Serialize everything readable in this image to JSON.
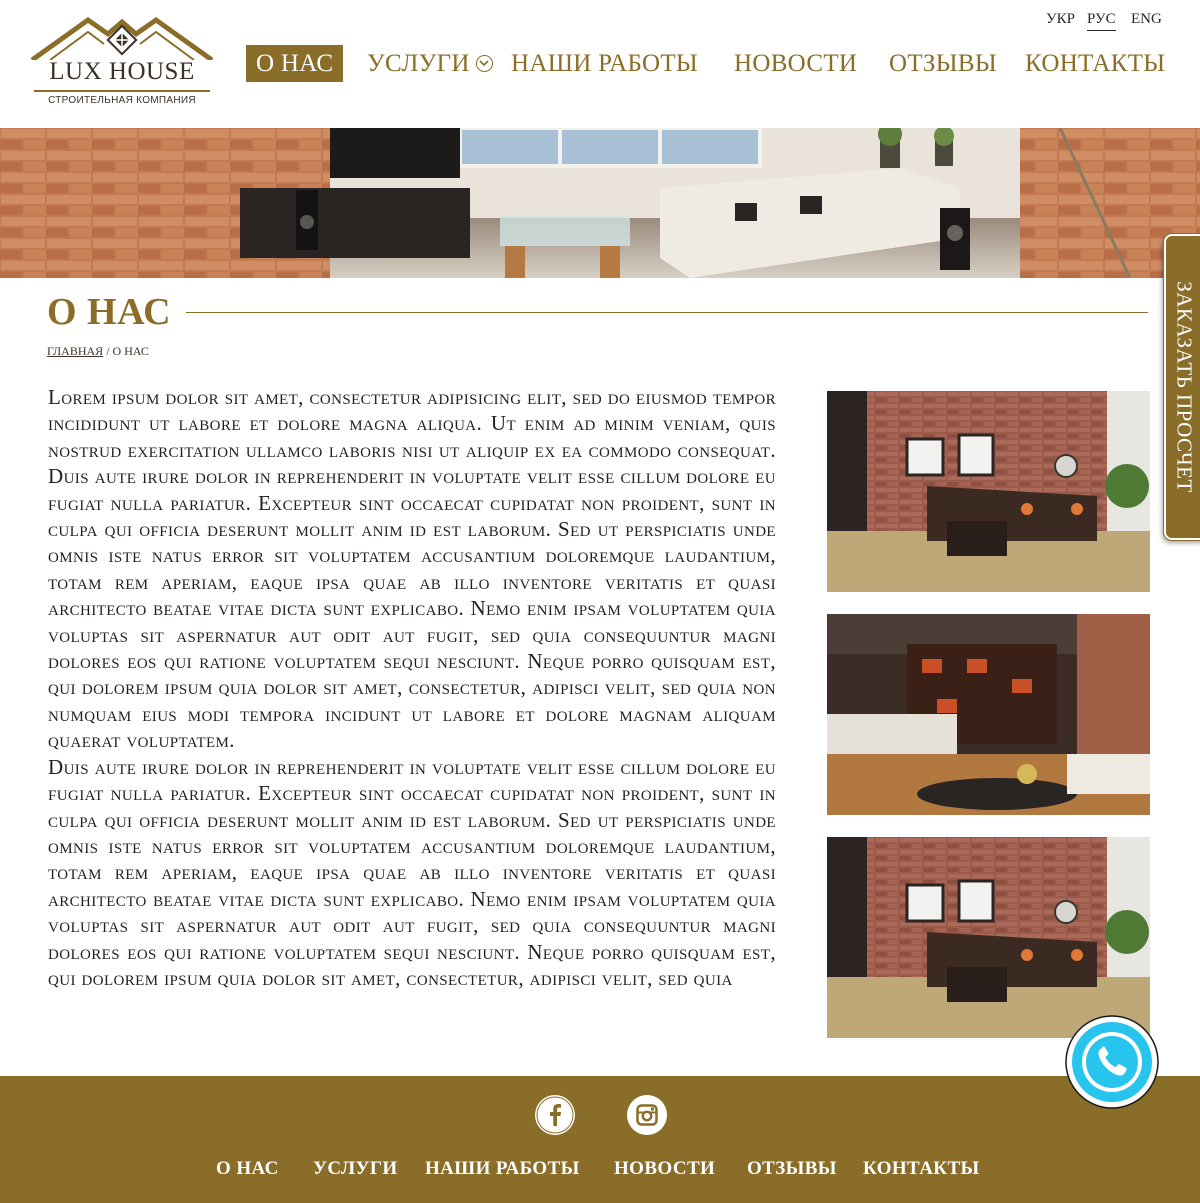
{
  "brand": {
    "name": "LUX HOUSE",
    "tagline": "СТРОИТЕЛЬНАЯ КОМПАНИЯ"
  },
  "languages": [
    {
      "label": "УКР",
      "active": false
    },
    {
      "label": "РУС",
      "active": true
    },
    {
      "label": "ENG",
      "active": false
    }
  ],
  "nav": [
    {
      "label": "О НАС",
      "active": true
    },
    {
      "label": "УСЛУГИ",
      "has_dropdown": true
    },
    {
      "label": "НАШИ РАБОТЫ"
    },
    {
      "label": "НОВОСТИ"
    },
    {
      "label": "ОТЗЫВЫ"
    },
    {
      "label": "КОНТАКТЫ"
    }
  ],
  "page": {
    "title": "О НАС",
    "breadcrumb": {
      "home": "ГЛАВНАЯ",
      "separator": " / ",
      "current": "О НАС"
    }
  },
  "article": {
    "paragraphs": [
      "Lorem ipsum dolor sit amet, consectetur adipisicing elit, sed do eiusmod tempor incididunt ut labore et dolore magna aliqua. Ut enim ad minim veniam, quis nostrud exercitation ullamco laboris nisi ut aliquip ex ea commodo consequat. Duis aute irure dolor in reprehenderit in voluptate velit esse cillum dolore eu fugiat nulla pariatur. Excepteur sint occaecat cupidatat non proident, sunt in culpa qui officia deserunt mollit anim id est laborum. Sed ut perspiciatis unde omnis iste natus error sit voluptatem accusantium doloremque laudantium, totam rem aperiam, eaque ipsa quae ab illo inventore veritatis et quasi architecto beatae vitae dicta sunt explicabo. Nemo enim ipsam voluptatem quia voluptas sit aspernatur aut odit aut fugit, sed quia consequuntur magni dolores eos qui ratione voluptatem sequi nesciunt. Neque porro quisquam est, qui dolorem ipsum quia dolor sit amet, consectetur, adipisci velit, sed quia non numquam eius modi tempora incidunt ut labore et dolore magnam aliquam quaerat voluptatem.",
      "Duis aute irure dolor in reprehenderit in voluptate velit esse cillum dolore eu fugiat nulla pariatur. Excepteur sint occaecat cupidatat non proident, sunt in culpa qui officia deserunt mollit anim id est laborum. Sed ut perspiciatis unde omnis iste natus error sit voluptatem accusantium doloremque laudantium, totam rem aperiam, eaque ipsa quae ab illo inventore veritatis et quasi architecto beatae vitae dicta sunt explicabo. Nemo enim ipsam voluptatem quia voluptas sit aspernatur aut odit aut fugit, sed quia consequuntur magni dolores eos qui ratione voluptatem sequi nesciunt. Neque porro quisquam est, qui dolorem ipsum quia dolor sit amet, consectetur, adipisci velit, sed quia"
    ]
  },
  "order_tab": {
    "label": "ЗАКАЗАТЬ ПРОСЧЕТ"
  },
  "footer": {
    "social": [
      "facebook-icon",
      "instagram-icon"
    ],
    "nav": [
      {
        "label": "О НАС"
      },
      {
        "label": "УСЛУГИ"
      },
      {
        "label": "НАШИ РАБОТЫ"
      },
      {
        "label": "НОВОСТИ"
      },
      {
        "label": "ОТЗЫВЫ"
      },
      {
        "label": "КОНТАКТЫ"
      }
    ]
  },
  "colors": {
    "brand_gold": "#8a6d28",
    "text_dark": "#231f1a",
    "call_blue": "#26c6ef"
  }
}
